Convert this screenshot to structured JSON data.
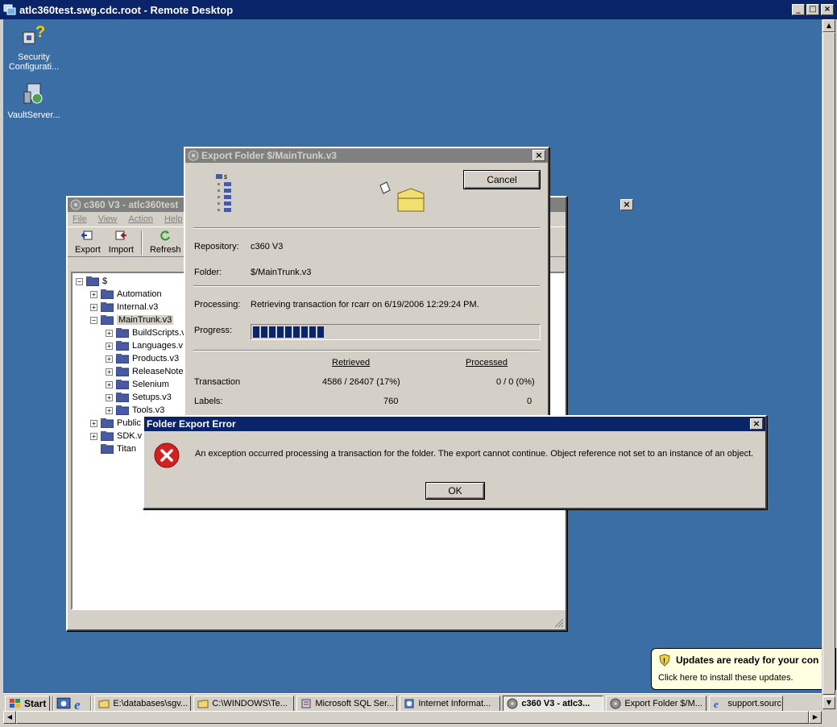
{
  "remote_desktop": {
    "title": "atlc360test.swg.cdc.root - Remote Desktop",
    "controls": [
      "_",
      "□",
      "×"
    ]
  },
  "desktop_icons": [
    {
      "label": "Security Configurati...",
      "icon": "security-config-icon"
    },
    {
      "label": "VaultServer...",
      "icon": "vault-installer-icon"
    }
  ],
  "vault_window": {
    "title": "c360 V3 - atlc360test",
    "menu": [
      "File",
      "View",
      "Action",
      "Help"
    ],
    "toolbar": {
      "export": "Export",
      "import": "Import",
      "refresh": "Refresh"
    },
    "tree": {
      "root": "$",
      "items": [
        {
          "label": "Automation",
          "level": 1,
          "expander": "+"
        },
        {
          "label": "Internal.v3",
          "level": 1,
          "expander": "+"
        },
        {
          "label": "MainTrunk.v3",
          "level": 1,
          "expander": "-",
          "selected": true
        },
        {
          "label": "BuildScripts.v",
          "level": 2,
          "expander": "+"
        },
        {
          "label": "Languages.v",
          "level": 2,
          "expander": "+"
        },
        {
          "label": "Products.v3",
          "level": 2,
          "expander": "+"
        },
        {
          "label": "ReleaseNote",
          "level": 2,
          "expander": "+"
        },
        {
          "label": "Selenium",
          "level": 2,
          "expander": "+"
        },
        {
          "label": "Setups.v3",
          "level": 2,
          "expander": "+"
        },
        {
          "label": "Tools.v3",
          "level": 2,
          "expander": "+"
        },
        {
          "label": "Public",
          "level": 1,
          "expander": "+"
        },
        {
          "label": "SDK.v",
          "level": 1,
          "expander": "+"
        },
        {
          "label": "Titan",
          "level": 1,
          "expander": ""
        }
      ]
    }
  },
  "export_dialog": {
    "title": "Export Folder $/MainTrunk.v3",
    "cancel": "Cancel",
    "repository_label": "Repository:",
    "repository_value": "c360 V3",
    "folder_label": "Folder:",
    "folder_value": "$/MainTrunk.v3",
    "processing_label": "Processing:",
    "processing_value": "Retrieving transaction for rcarr on 6/19/2006 12:29:24 PM.",
    "progress_label": "Progress:",
    "progress_blocks": 9,
    "col_retrieved": "Retrieved",
    "col_processed": "Processed",
    "row_transaction": "Transaction",
    "transaction_retrieved": "4586 / 26407 (17%)",
    "transaction_processed": "0 / 0 (0%)",
    "row_labels": "Labels:",
    "labels_retrieved": "760",
    "labels_processed": "0"
  },
  "error_dialog": {
    "title": "Folder Export Error",
    "message": "An exception occurred processing a transaction for the folder.  The export cannot continue. Object reference not set to an instance of an object.",
    "ok": "OK"
  },
  "balloon": {
    "title": "Updates are ready for your con",
    "text": "Click here to install these updates."
  },
  "taskbar": {
    "start": "Start",
    "items": [
      {
        "label": "E:\\databases\\sgv...",
        "icon": "folder-icon"
      },
      {
        "label": "C:\\WINDOWS\\Te...",
        "icon": "folder-icon"
      },
      {
        "label": "Microsoft SQL Ser...",
        "icon": "sql-server-icon"
      },
      {
        "label": "Internet Informat...",
        "icon": "iis-icon"
      },
      {
        "label": "c360 V3 - atlc3...",
        "icon": "vault-icon",
        "pressed": true
      },
      {
        "label": "Export Folder $/M...",
        "icon": "vault-icon"
      },
      {
        "label": "support.sourc",
        "icon": "ie-icon"
      }
    ]
  },
  "colors": {
    "desktop": "#3a6ea5",
    "active_title": "#0a246a",
    "window_face": "#d4d0c8",
    "error_red": "#d32020"
  }
}
